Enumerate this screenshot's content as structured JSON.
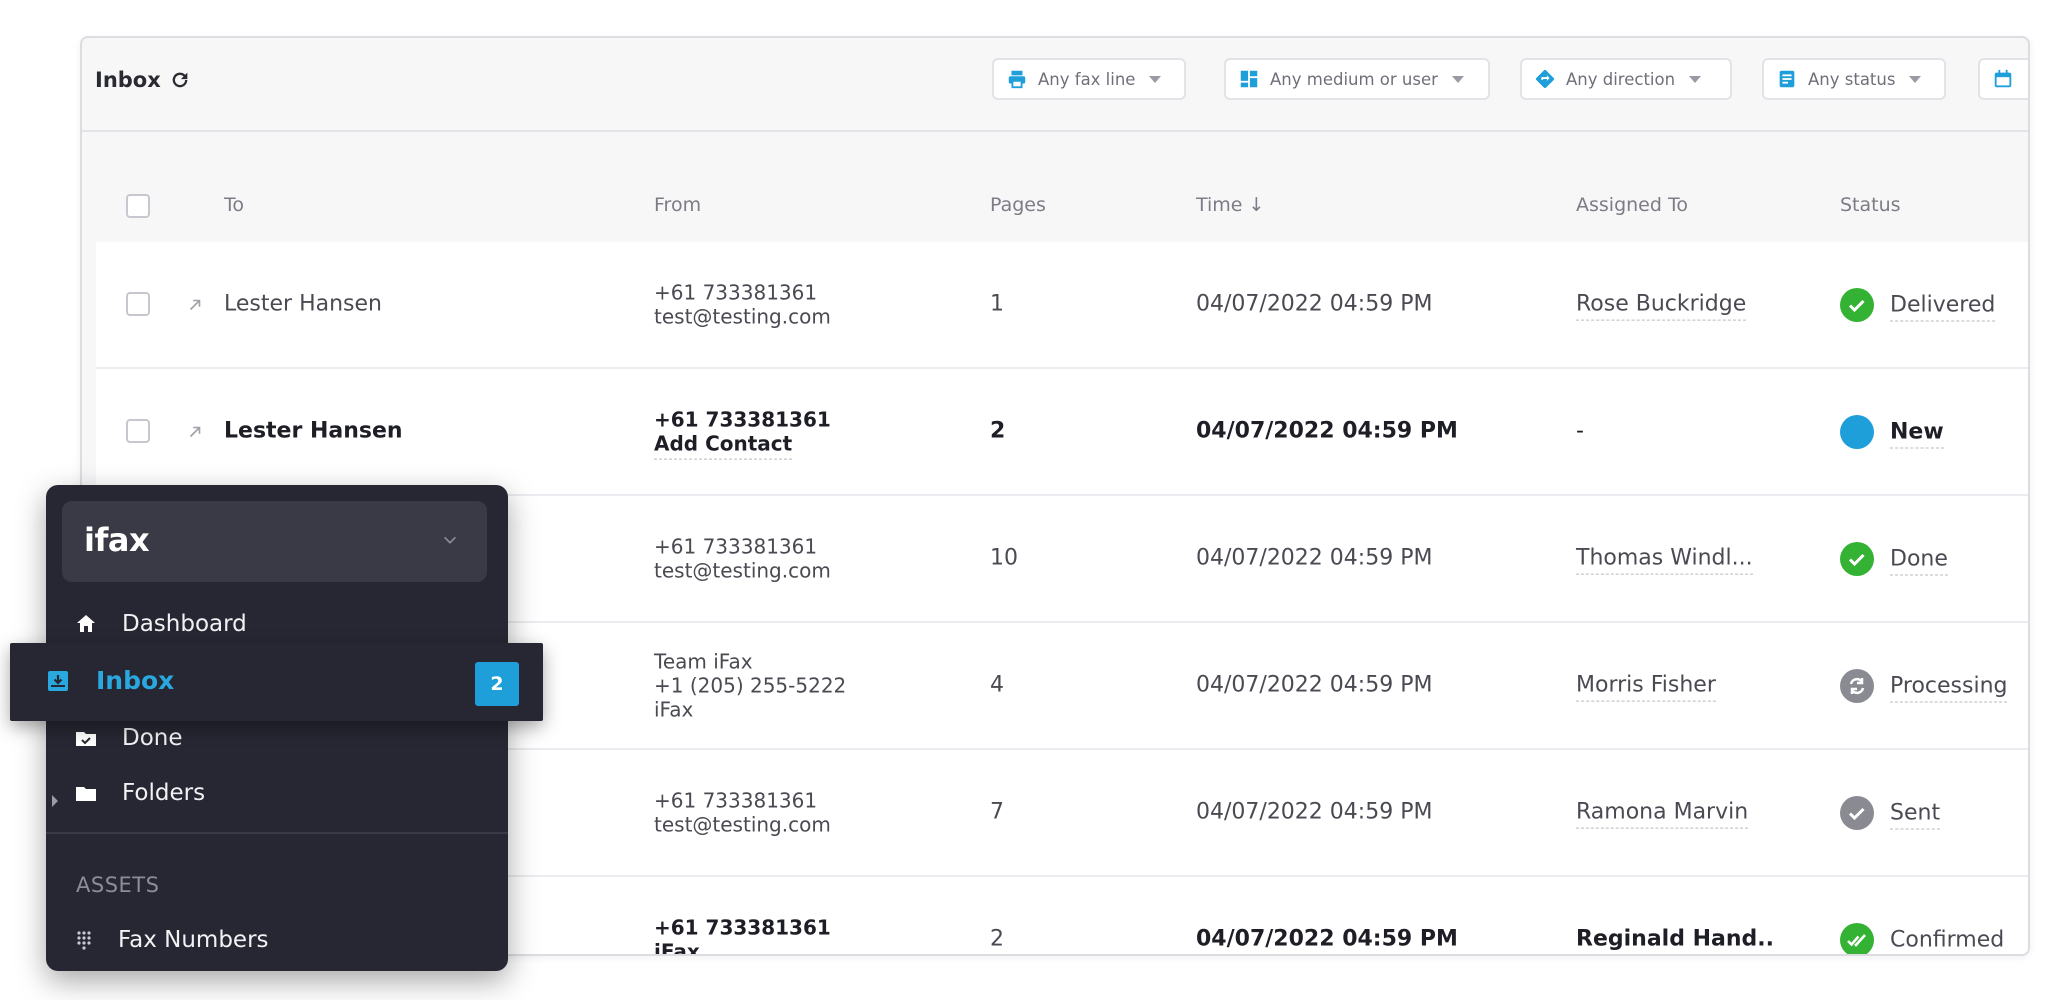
{
  "header": {
    "title": "Inbox",
    "filters": [
      {
        "label": "Any fax line",
        "icon": "printer-icon"
      },
      {
        "label": "Any medium or user",
        "icon": "grid-icon"
      },
      {
        "label": "Any direction",
        "icon": "direction-icon"
      },
      {
        "label": "Any status",
        "icon": "status-doc-icon"
      },
      {
        "label": "",
        "icon": "calendar-icon"
      }
    ]
  },
  "table": {
    "columns": {
      "to": "To",
      "from": "From",
      "pages": "Pages",
      "time": "Time ↓",
      "assigned": "Assigned To",
      "status": "Status"
    },
    "rows": [
      {
        "to": "Lester Hansen",
        "from1": "+61 733381361",
        "from2": "test@testing.com",
        "from3": "",
        "pages": "1",
        "time": "04/07/2022 04:59 PM",
        "assigned": "Rose Buckridge",
        "status": "Delivered",
        "status_color": "#34b233"
      },
      {
        "to": "Lester Hansen",
        "from1": "+61 733381361",
        "from2": "Add Contact",
        "from3": "",
        "pages": "2",
        "time": "04/07/2022 04:59 PM",
        "assigned": "-",
        "status": "New",
        "status_color": "#1e9fda"
      },
      {
        "to": "",
        "from1": "+61 733381361",
        "from2": "test@testing.com",
        "from3": "",
        "pages": "10",
        "time": "04/07/2022 04:59 PM",
        "assigned": "Thomas Windl...",
        "status": "Done",
        "status_color": "#34b233"
      },
      {
        "to": "",
        "from1": "Team iFax",
        "from2": "+1 (205) 255-5222",
        "from3": "iFax",
        "pages": "4",
        "time": "04/07/2022 04:59 PM",
        "assigned": "Morris Fisher",
        "status": "Processing",
        "status_color": "#8a8a92"
      },
      {
        "to": "",
        "from1": "+61 733381361",
        "from2": "test@testing.com",
        "from3": "",
        "pages": "7",
        "time": "04/07/2022 04:59 PM",
        "assigned": "Ramona Marvin",
        "status": "Sent",
        "status_color": "#8a8a92"
      },
      {
        "to": "",
        "from1": "+61 733381361",
        "from2": "iFax",
        "from3": "",
        "pages": "2",
        "time": "04/07/2022 04:59 PM",
        "assigned": "Reginald Hand..",
        "status": "Confirmed",
        "status_color": "#34b233"
      }
    ]
  },
  "sidebar": {
    "brand": "ifax",
    "items": [
      {
        "label": "Dashboard",
        "icon": "home-icon"
      },
      {
        "label": "Inbox",
        "icon": "inbox-icon",
        "badge": "2"
      },
      {
        "label": "Done",
        "icon": "done-folder-icon"
      },
      {
        "label": "Folders",
        "icon": "folder-icon"
      }
    ],
    "section": "ASSETS",
    "assets": [
      {
        "label": "Fax Numbers",
        "icon": "dialpad-icon"
      }
    ]
  },
  "colors": {
    "accent": "#29a8e0",
    "sidebar_bg": "#272733",
    "success": "#34b233"
  }
}
